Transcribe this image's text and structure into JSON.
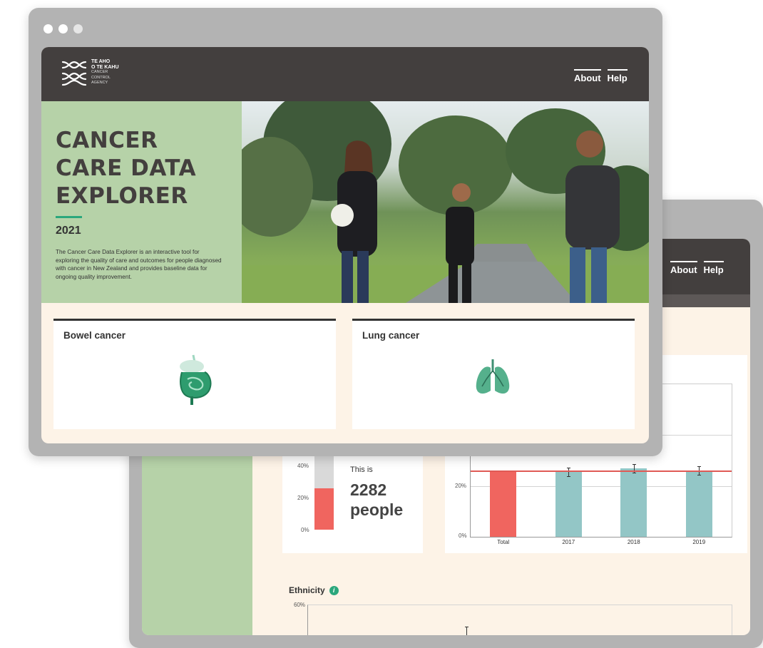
{
  "back_window": {
    "nav": {
      "about": "About",
      "help": "Help"
    },
    "proportion_card": {
      "y_ticks": [
        "40%",
        "20%",
        "0%"
      ],
      "fill_fraction": 0.26,
      "intro": "This is",
      "count": "2282",
      "unit": "people"
    },
    "year_chart": {
      "y_ticks": [
        "20%",
        "0%"
      ],
      "x_labels": [
        "Total",
        "2017",
        "2018",
        "2019"
      ]
    },
    "ethnicity": {
      "title": "Ethnicity",
      "y_tick": "60%"
    }
  },
  "chart_data": {
    "type": "bar",
    "categories": [
      "Total",
      "2017",
      "2018",
      "2019"
    ],
    "values": [
      26,
      25.5,
      27,
      26
    ],
    "reference_line": 26,
    "ylim": [
      0,
      60
    ],
    "colors": {
      "total": "#f0655f",
      "year": "#93c6c6",
      "reference": "#e05a55"
    },
    "title": "",
    "xlabel": "",
    "ylabel": ""
  },
  "front_window": {
    "logo": {
      "line1": "TE AHO",
      "line2": "O TE KAHU",
      "line3": "CANCER",
      "line4": "CONTROL",
      "line5": "AGENCY"
    },
    "nav": {
      "about": "About",
      "help": "Help"
    },
    "hero": {
      "title_1": "CANCER",
      "title_2": "CARE DATA",
      "title_3": "EXPLORER",
      "year": "2021",
      "description": "The Cancer Care Data Explorer is an interactive tool for exploring the quality of care and outcomes for people diagnosed with cancer in New Zealand and provides baseline data for ongoing quality improvement."
    },
    "tiles": [
      {
        "label": "Bowel cancer",
        "icon": "intestine-icon"
      },
      {
        "label": "Lung cancer",
        "icon": "lungs-icon"
      }
    ]
  },
  "colors": {
    "header": "#433f3e",
    "sage": "#b6d2a8",
    "cream": "#fdf3e7",
    "accent": "#2ba77c",
    "frame": "#b3b3b3"
  }
}
